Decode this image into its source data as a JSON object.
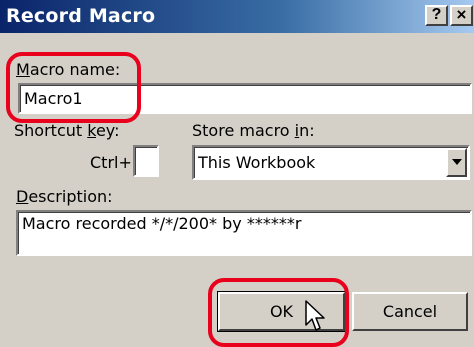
{
  "dialog": {
    "title": "Record Macro",
    "help_button": "?",
    "close_button": "×"
  },
  "macro_name": {
    "label_prefix": "",
    "label_access": "M",
    "label_rest": "acro name:",
    "value": "Macro1"
  },
  "shortcut": {
    "label_prefix": "Shortcut ",
    "label_access": "k",
    "label_rest": "ey:",
    "ctrl_text": "Ctrl+",
    "value": ""
  },
  "store_in": {
    "label_prefix": "Store macro ",
    "label_access": "i",
    "label_rest": "n:",
    "selected": "This Workbook"
  },
  "description": {
    "label_prefix": "",
    "label_access": "D",
    "label_rest": "escription:",
    "value": "Macro recorded */*/200* by ******r"
  },
  "buttons": {
    "ok": "OK",
    "cancel": "Cancel"
  },
  "colors": {
    "highlight": "#e8001c",
    "title_bar": "#0a246a",
    "dialog_face": "#d4d0c8"
  },
  "icons": {
    "cursor": "arrow-pointer-icon"
  }
}
